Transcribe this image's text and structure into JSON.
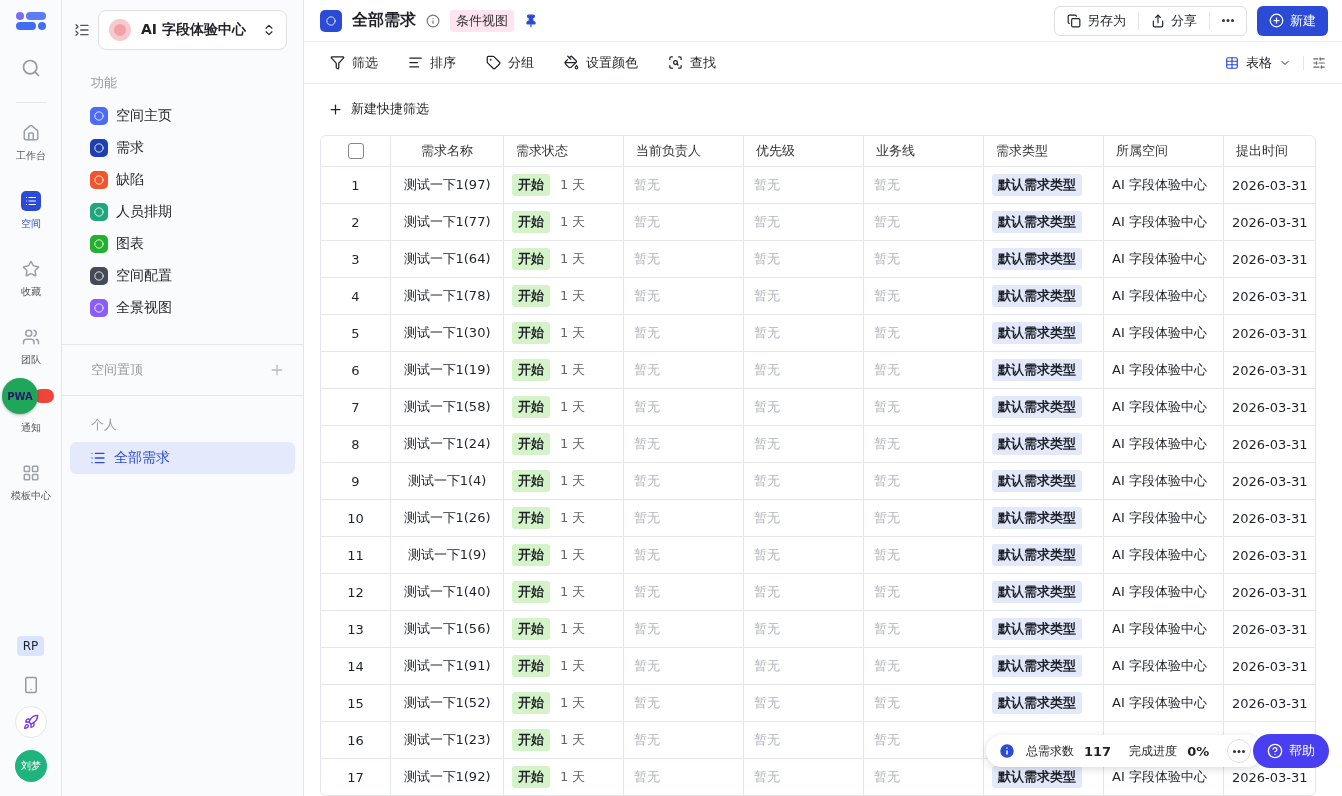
{
  "rail": {
    "items": [
      {
        "label": "工作台",
        "selected": false
      },
      {
        "label": "空间",
        "selected": true
      },
      {
        "label": "收藏",
        "selected": false
      },
      {
        "label": "团队",
        "selected": false
      },
      {
        "label": "通知",
        "selected": false
      },
      {
        "label": "模板中心",
        "selected": false
      }
    ],
    "badge_user": "RP",
    "avatar": "刘梦",
    "pwa": "PWA"
  },
  "sidebar": {
    "space_name": "AI 字段体验中心",
    "section_features": "功能",
    "features": [
      {
        "label": "空间主页",
        "color": "#4a6cf7"
      },
      {
        "label": "需求",
        "color": "#1f3fb0"
      },
      {
        "label": "缺陷",
        "color": "#f2552c"
      },
      {
        "label": "人员排期",
        "color": "#1fa67a"
      },
      {
        "label": "图表",
        "color": "#22b02e"
      },
      {
        "label": "空间配置",
        "color": "#444b57"
      },
      {
        "label": "全景视图",
        "color": "#8b5cf6"
      }
    ],
    "section_pinned": "空间置顶",
    "section_personal": "个人",
    "personal": [
      {
        "label": "全部需求",
        "selected": true
      }
    ]
  },
  "header": {
    "title": "全部需求",
    "view_tag": "条件视图",
    "save_as": "另存为",
    "share": "分享",
    "new": "新建"
  },
  "toolbar": {
    "items": [
      "筛选",
      "排序",
      "分组",
      "设置颜色",
      "查找"
    ],
    "view": "表格"
  },
  "quick_filter": "新建快捷筛选",
  "table": {
    "select_all_checked": false,
    "columns": [
      "需求名称",
      "需求状态",
      "当前负责人",
      "优先级",
      "业务线",
      "需求类型",
      "所属空间",
      "提出时间"
    ],
    "rows": [
      {
        "index": "1",
        "name": "测试一下1(97)",
        "status": "开始",
        "duration": "1 天",
        "owner": "暂无",
        "priority": "暂无",
        "line": "暂无",
        "type": "默认需求类型",
        "space": "AI 字段体验中心",
        "date": "2026-03-31"
      },
      {
        "index": "2",
        "name": "测试一下1(77)",
        "status": "开始",
        "duration": "1 天",
        "owner": "暂无",
        "priority": "暂无",
        "line": "暂无",
        "type": "默认需求类型",
        "space": "AI 字段体验中心",
        "date": "2026-03-31"
      },
      {
        "index": "3",
        "name": "测试一下1(64)",
        "status": "开始",
        "duration": "1 天",
        "owner": "暂无",
        "priority": "暂无",
        "line": "暂无",
        "type": "默认需求类型",
        "space": "AI 字段体验中心",
        "date": "2026-03-31"
      },
      {
        "index": "4",
        "name": "测试一下1(78)",
        "status": "开始",
        "duration": "1 天",
        "owner": "暂无",
        "priority": "暂无",
        "line": "暂无",
        "type": "默认需求类型",
        "space": "AI 字段体验中心",
        "date": "2026-03-31"
      },
      {
        "index": "5",
        "name": "测试一下1(30)",
        "status": "开始",
        "duration": "1 天",
        "owner": "暂无",
        "priority": "暂无",
        "line": "暂无",
        "type": "默认需求类型",
        "space": "AI 字段体验中心",
        "date": "2026-03-31"
      },
      {
        "index": "6",
        "name": "测试一下1(19)",
        "status": "开始",
        "duration": "1 天",
        "owner": "暂无",
        "priority": "暂无",
        "line": "暂无",
        "type": "默认需求类型",
        "space": "AI 字段体验中心",
        "date": "2026-03-31"
      },
      {
        "index": "7",
        "name": "测试一下1(58)",
        "status": "开始",
        "duration": "1 天",
        "owner": "暂无",
        "priority": "暂无",
        "line": "暂无",
        "type": "默认需求类型",
        "space": "AI 字段体验中心",
        "date": "2026-03-31"
      },
      {
        "index": "8",
        "name": "测试一下1(24)",
        "status": "开始",
        "duration": "1 天",
        "owner": "暂无",
        "priority": "暂无",
        "line": "暂无",
        "type": "默认需求类型",
        "space": "AI 字段体验中心",
        "date": "2026-03-31"
      },
      {
        "index": "9",
        "name": "测试一下1(4)",
        "status": "开始",
        "duration": "1 天",
        "owner": "暂无",
        "priority": "暂无",
        "line": "暂无",
        "type": "默认需求类型",
        "space": "AI 字段体验中心",
        "date": "2026-03-31"
      },
      {
        "index": "10",
        "name": "测试一下1(26)",
        "status": "开始",
        "duration": "1 天",
        "owner": "暂无",
        "priority": "暂无",
        "line": "暂无",
        "type": "默认需求类型",
        "space": "AI 字段体验中心",
        "date": "2026-03-31"
      },
      {
        "index": "11",
        "name": "测试一下1(9)",
        "status": "开始",
        "duration": "1 天",
        "owner": "暂无",
        "priority": "暂无",
        "line": "暂无",
        "type": "默认需求类型",
        "space": "AI 字段体验中心",
        "date": "2026-03-31"
      },
      {
        "index": "12",
        "name": "测试一下1(40)",
        "status": "开始",
        "duration": "1 天",
        "owner": "暂无",
        "priority": "暂无",
        "line": "暂无",
        "type": "默认需求类型",
        "space": "AI 字段体验中心",
        "date": "2026-03-31"
      },
      {
        "index": "13",
        "name": "测试一下1(56)",
        "status": "开始",
        "duration": "1 天",
        "owner": "暂无",
        "priority": "暂无",
        "line": "暂无",
        "type": "默认需求类型",
        "space": "AI 字段体验中心",
        "date": "2026-03-31"
      },
      {
        "index": "14",
        "name": "测试一下1(91)",
        "status": "开始",
        "duration": "1 天",
        "owner": "暂无",
        "priority": "暂无",
        "line": "暂无",
        "type": "默认需求类型",
        "space": "AI 字段体验中心",
        "date": "2026-03-31"
      },
      {
        "index": "15",
        "name": "测试一下1(52)",
        "status": "开始",
        "duration": "1 天",
        "owner": "暂无",
        "priority": "暂无",
        "line": "暂无",
        "type": "默认需求类型",
        "space": "AI 字段体验中心",
        "date": "2026-03-31"
      },
      {
        "index": "16",
        "name": "测试一下1(23)",
        "status": "开始",
        "duration": "1 天",
        "owner": "暂无",
        "priority": "暂无",
        "line": "暂无"
      },
      {
        "index": "17",
        "name": "测试一下1(92)",
        "status": "开始",
        "duration": "1 天",
        "owner": "暂无",
        "priority": "暂无",
        "line": "暂无",
        "type": "默认需求类型",
        "space": "AI 字段体验中心",
        "date": "2026-03-31"
      }
    ]
  },
  "stats": {
    "total_label": "总需求数",
    "total": "117",
    "progress_label": "完成进度",
    "progress": "0%"
  },
  "help": "帮助"
}
